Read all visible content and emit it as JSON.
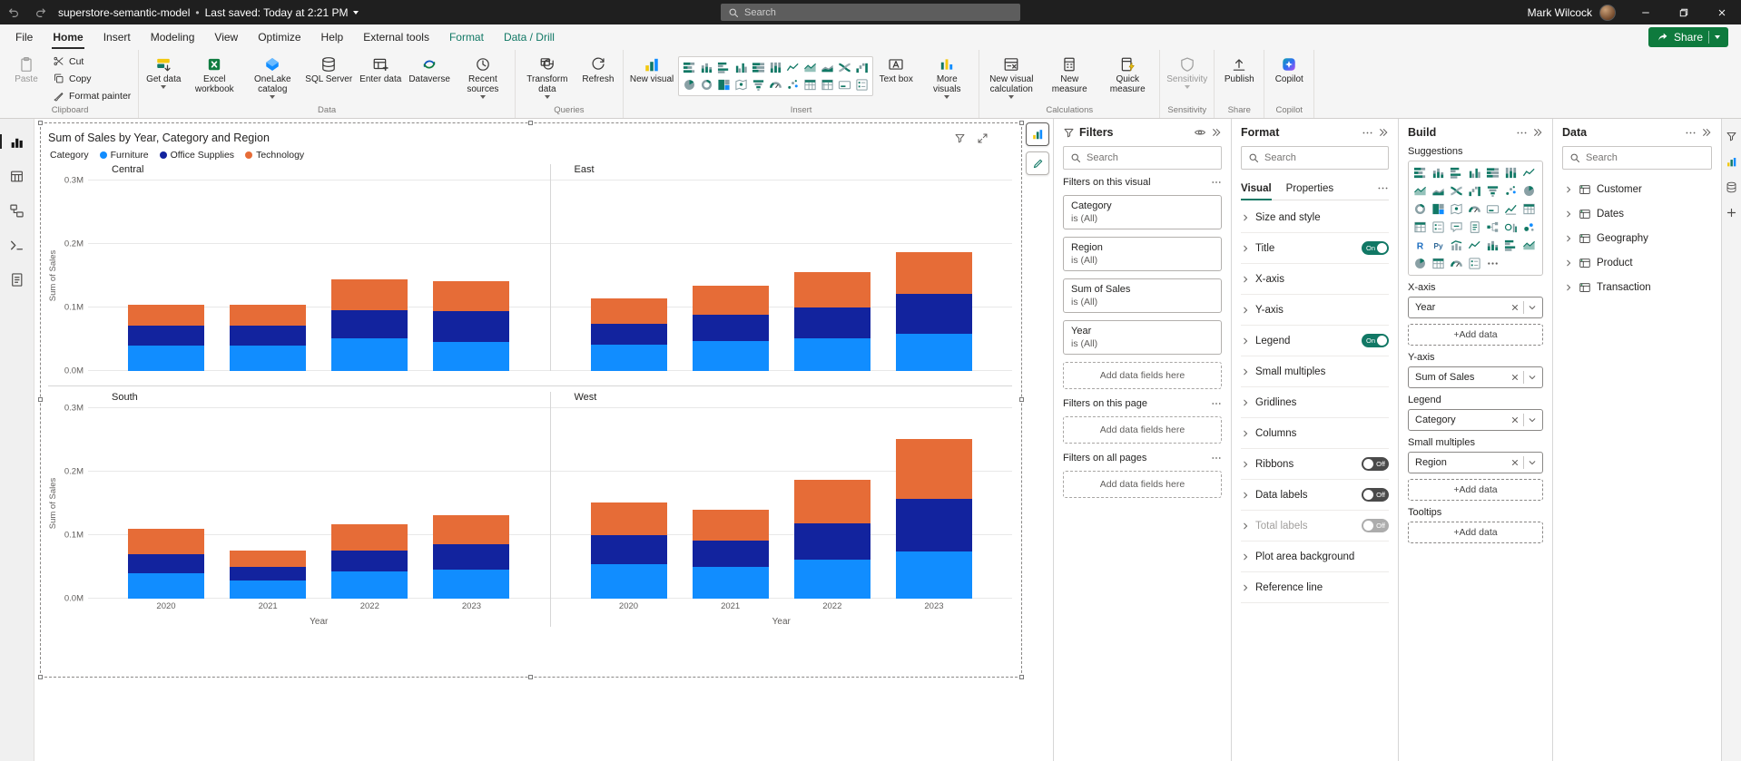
{
  "titlebar": {
    "app_title": "superstore-semantic-model",
    "separator": "•",
    "last_saved": "Last saved: Today at 2:21 PM",
    "search_placeholder": "Search",
    "user_name": "Mark Wilcock"
  },
  "ribbon": {
    "tabs": [
      {
        "label": "File"
      },
      {
        "label": "Home",
        "active": true
      },
      {
        "label": "Insert"
      },
      {
        "label": "Modeling"
      },
      {
        "label": "View"
      },
      {
        "label": "Optimize"
      },
      {
        "label": "Help"
      },
      {
        "label": "External tools"
      },
      {
        "label": "Format",
        "contextual": true
      },
      {
        "label": "Data / Drill",
        "contextual": true
      }
    ],
    "share_button": "Share",
    "groups": {
      "clipboard": {
        "label": "Clipboard",
        "paste": "Paste",
        "cut": "Cut",
        "copy": "Copy",
        "format_painter": "Format painter"
      },
      "data": {
        "label": "Data",
        "get_data": "Get data",
        "excel": "Excel workbook",
        "onelake": "OneLake catalog",
        "sql": "SQL Server",
        "enter": "Enter data",
        "dataverse": "Dataverse",
        "recent": "Recent sources"
      },
      "queries": {
        "label": "Queries",
        "transform": "Transform data",
        "refresh": "Refresh"
      },
      "insert": {
        "label": "Insert",
        "new_visual": "New visual",
        "text_box": "Text box",
        "more_visuals": "More visuals"
      },
      "calculations": {
        "label": "Calculations",
        "new_visual_calc": "New visual calculation",
        "new_measure": "New measure",
        "quick_measure": "Quick measure"
      },
      "sensitivity": {
        "label": "Sensitivity",
        "sensitivity": "Sensitivity"
      },
      "share": {
        "label": "Share",
        "publish": "Publish"
      },
      "copilot": {
        "label": "Copilot",
        "copilot": "Copilot"
      }
    },
    "insert_gallery": [
      [
        "stacked-bar",
        "stacked-col",
        "clustered-bar",
        "clustered-col",
        "pct-bar",
        "pct-col",
        "line",
        "area",
        "stacked-area",
        "ribbon",
        "waterfall"
      ],
      [
        "pie",
        "donut",
        "treemap",
        "map",
        "funnel",
        "gauge",
        "scatter",
        "table",
        "matrix",
        "card",
        "slicer"
      ]
    ]
  },
  "filters_pane": {
    "title": "Filters",
    "search_placeholder": "Search",
    "sections": [
      {
        "label": "Filters on this visual",
        "cards": [
          {
            "field": "Category",
            "value": "is (All)"
          },
          {
            "field": "Region",
            "value": "is (All)"
          },
          {
            "field": "Sum of Sales",
            "value": "is (All)"
          },
          {
            "field": "Year",
            "value": "is (All)"
          }
        ],
        "add_label": "Add data fields here"
      },
      {
        "label": "Filters on this page",
        "cards": [],
        "add_label": "Add data fields here"
      },
      {
        "label": "Filters on all pages",
        "cards": [],
        "add_label": "Add data fields here"
      }
    ]
  },
  "format_pane": {
    "title": "Format",
    "search_placeholder": "Search",
    "tabs": [
      "Visual",
      "Properties"
    ],
    "active_tab": "Visual",
    "sections": [
      {
        "label": "Size and style"
      },
      {
        "label": "Title",
        "toggle": "On"
      },
      {
        "label": "X-axis"
      },
      {
        "label": "Y-axis"
      },
      {
        "label": "Legend",
        "toggle": "On"
      },
      {
        "label": "Small multiples"
      },
      {
        "label": "Gridlines"
      },
      {
        "label": "Columns"
      },
      {
        "label": "Ribbons",
        "toggle": "Off"
      },
      {
        "label": "Data labels",
        "toggle": "Off"
      },
      {
        "label": "Total labels",
        "toggle": "Off",
        "disabled": true
      },
      {
        "label": "Plot area background"
      },
      {
        "label": "Reference line"
      }
    ]
  },
  "build_pane": {
    "title": "Build",
    "suggestions_label": "Suggestions",
    "suggestions": [
      [
        "stacked-bar",
        "stacked-col",
        "clustered-bar",
        "clustered-col",
        "pct-bar",
        "pct-col",
        "line"
      ],
      [
        "area",
        "stacked-area",
        "ribbon",
        "waterfall",
        "funnel",
        "scatter",
        "pie"
      ],
      [
        "donut",
        "treemap",
        "map",
        "gauge",
        "card",
        "kpi",
        "table"
      ],
      [
        "matrix",
        "slicer",
        "qa",
        "doc",
        "decomp",
        "influencer",
        "bubble"
      ],
      [
        "R",
        "Py",
        "combo",
        "line",
        "stacked-col",
        "clustered-bar",
        "area"
      ],
      [
        "pie",
        "table",
        "gauge",
        "slicer",
        "ellipsis"
      ]
    ],
    "wells": [
      {
        "label": "X-axis",
        "pills": [
          "Year"
        ],
        "show_add": true
      },
      {
        "label": "Y-axis",
        "pills": [
          "Sum of Sales"
        ],
        "show_add": false
      },
      {
        "label": "Legend",
        "pills": [
          "Category"
        ],
        "show_add": false
      },
      {
        "label": "Small multiples",
        "pills": [
          "Region"
        ],
        "show_add": true
      },
      {
        "label": "Tooltips",
        "pills": [],
        "show_add": true
      }
    ],
    "add_data_label": "+Add data"
  },
  "data_pane": {
    "title": "Data",
    "search_placeholder": "Search",
    "tables": [
      "Customer",
      "Dates",
      "Geography",
      "Product",
      "Transaction"
    ]
  },
  "chart_data": {
    "type": "bar",
    "stacked": true,
    "title": "Sum of Sales by Year, Category and Region",
    "legend_title": "Category",
    "series_names": [
      "Furniture",
      "Office Supplies",
      "Technology"
    ],
    "series_colors": [
      "#118DFF",
      "#12239E",
      "#E66C37"
    ],
    "categories": [
      "2020",
      "2021",
      "2022",
      "2023"
    ],
    "xlabel": "Year",
    "ylabel": "Sum of Sales",
    "ylim": [
      0,
      0.3
    ],
    "ytick_labels": [
      "0.0M",
      "0.1M",
      "0.2M",
      "0.3M"
    ],
    "grid": true,
    "legend_position": "top",
    "small_multiples": [
      {
        "region": "Central",
        "series": [
          {
            "name": "Furniture",
            "values": [
              0.04,
              0.04,
              0.052,
              0.046
            ]
          },
          {
            "name": "Office Supplies",
            "values": [
              0.031,
              0.032,
              0.044,
              0.049
            ]
          },
          {
            "name": "Technology",
            "values": [
              0.034,
              0.033,
              0.049,
              0.047
            ]
          }
        ]
      },
      {
        "region": "East",
        "series": [
          {
            "name": "Furniture",
            "values": [
              0.042,
              0.047,
              0.052,
              0.058
            ]
          },
          {
            "name": "Office Supplies",
            "values": [
              0.033,
              0.041,
              0.048,
              0.063
            ]
          },
          {
            "name": "Technology",
            "values": [
              0.04,
              0.047,
              0.056,
              0.066
            ]
          }
        ]
      },
      {
        "region": "South",
        "series": [
          {
            "name": "Furniture",
            "values": [
              0.04,
              0.028,
              0.043,
              0.046
            ]
          },
          {
            "name": "Office Supplies",
            "values": [
              0.03,
              0.022,
              0.033,
              0.04
            ]
          },
          {
            "name": "Technology",
            "values": [
              0.04,
              0.026,
              0.041,
              0.046
            ]
          }
        ]
      },
      {
        "region": "West",
        "series": [
          {
            "name": "Furniture",
            "values": [
              0.055,
              0.05,
              0.061,
              0.075
            ]
          },
          {
            "name": "Office Supplies",
            "values": [
              0.045,
              0.042,
              0.058,
              0.082
            ]
          },
          {
            "name": "Technology",
            "values": [
              0.051,
              0.048,
              0.068,
              0.094
            ]
          }
        ]
      }
    ]
  }
}
